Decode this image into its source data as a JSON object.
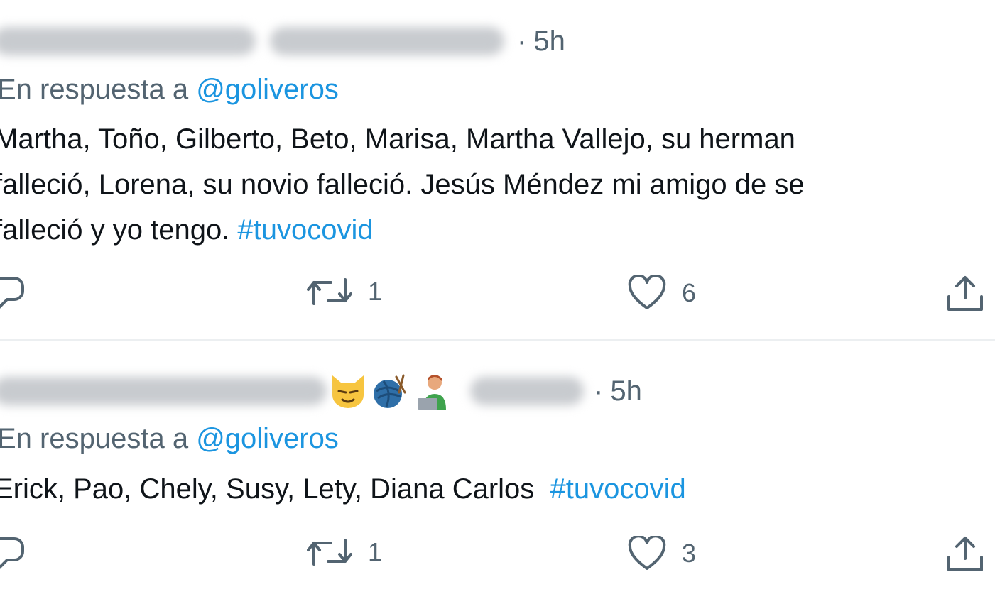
{
  "tweets": [
    {
      "time": "5h",
      "reply_prefix": "En respuesta a",
      "reply_mention": "@goliveros",
      "lines": [
        "Martha, Toño, Gilberto, Beto, Marisa, Martha Vallejo, su herman",
        "falleció, Lorena, su novio falleció. Jesús Méndez mi amigo de se",
        "falleció y yo tengo. "
      ],
      "hashtag": "#tuvocovid",
      "retweets": "1",
      "likes": "6"
    },
    {
      "time": "5h",
      "reply_prefix": "En respuesta a",
      "reply_mention": "@goliveros",
      "lines": [
        "Erick, Pao, Chely, Susy, Lety, Diana Carlos  "
      ],
      "hashtag": "#tuvocovid",
      "retweets": "1",
      "likes": "3"
    }
  ],
  "icons": {
    "reply": "reply-icon",
    "retweet": "retweet-icon",
    "like": "heart-icon",
    "share": "share-icon",
    "emoji_1": "smirking-cat-emoji",
    "emoji_2": "yarn-ball-emoji",
    "emoji_3": "technologist-emoji"
  },
  "colors": {
    "link": "#1b95e0",
    "secondary_text": "#536471",
    "primary_text": "#0f1419",
    "divider": "#eceff1"
  }
}
